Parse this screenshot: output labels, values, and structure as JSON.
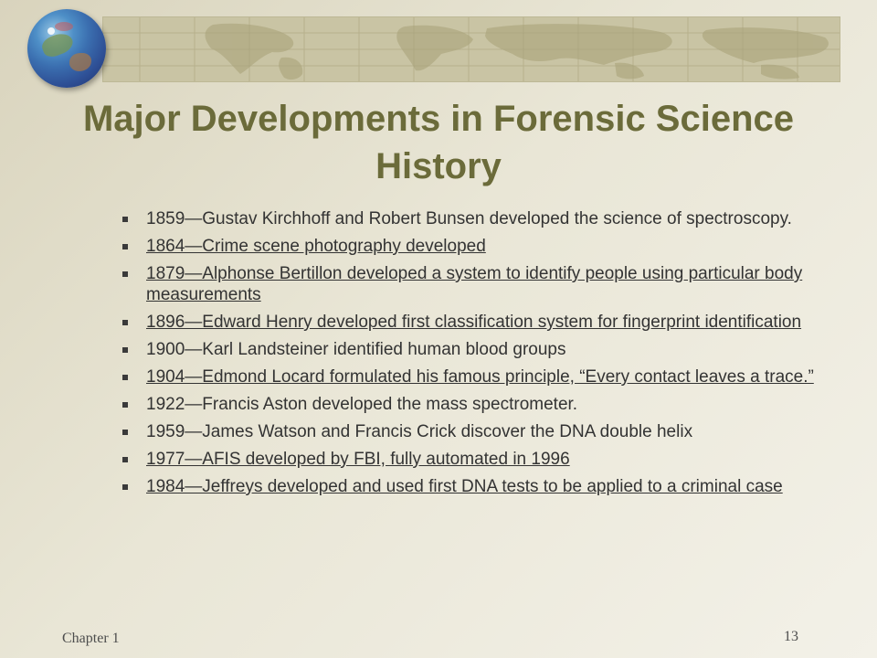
{
  "slide": {
    "title": "Major Developments in Forensic Science History",
    "bullets": [
      {
        "text": "1859—Gustav Kirchhoff and Robert Bunsen developed the science of spectroscopy.",
        "link": false
      },
      {
        "text": "1864—Crime scene photography developed",
        "link": true
      },
      {
        "text": "1879—Alphonse Bertillon developed a system to identify people using particular body measurements",
        "link": true
      },
      {
        "text": "1896—Edward Henry developed first classification system for fingerprint identification",
        "link": true
      },
      {
        "text": "1900—Karl Landsteiner identified human blood groups",
        "link": false
      },
      {
        "text": "1904—Edmond Locard formulated his famous principle, “Every contact leaves a trace.”",
        "link": true
      },
      {
        "text": "1922—Francis Aston developed the mass spectrometer.",
        "link": false
      },
      {
        "text": "1959—James Watson and Francis Crick discover the DNA double helix",
        "link": false
      },
      {
        "text": "1977—AFIS developed by FBI, fully automated in 1996",
        "link": true
      },
      {
        "text": "1984—Jeffreys developed and used first DNA tests to be applied to a criminal case",
        "link": true
      }
    ],
    "footer": {
      "chapter": "Chapter 1",
      "page": "13"
    }
  },
  "colors": {
    "title": "#6b6b3a",
    "text": "#333333",
    "banner": "#c9c4a4"
  },
  "icons": {
    "logo": "globe-icon",
    "banner": "world-map-banner",
    "bullet": "square-bullet-icon"
  }
}
